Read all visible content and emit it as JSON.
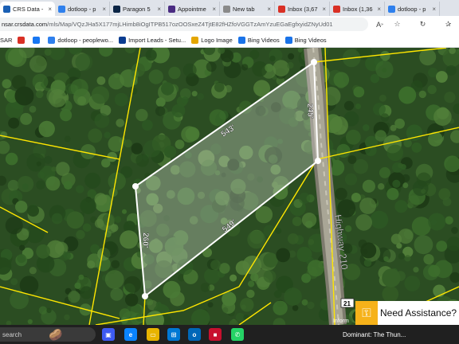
{
  "tabs": [
    {
      "label": "CRS Data -",
      "icon": "crs-icon",
      "color": "#1a5fb4",
      "active": true
    },
    {
      "label": "dotloop - p",
      "icon": "dotloop-icon",
      "color": "#2f80ed"
    },
    {
      "label": "Paragon 5",
      "icon": "paragon-icon",
      "color": "#0b2545"
    },
    {
      "label": "Appointme",
      "icon": "appointment-icon",
      "color": "#4a2c82"
    },
    {
      "label": "New tab",
      "icon": "newtab-icon",
      "color": "#8a8a8a"
    },
    {
      "label": "Inbox (3,67",
      "icon": "gmail-icon",
      "color": "#d93025"
    },
    {
      "label": "Inbox (1,36",
      "icon": "gmail-icon",
      "color": "#d93025"
    },
    {
      "label": "dotloop - p",
      "icon": "dotloop-icon",
      "color": "#2f80ed"
    }
  ],
  "address": {
    "host": "nsar.crsdata.com",
    "path": "/mls/Map/VQzJHa5X177mjLHimb8iOgITPB517ozOOSxeZ4TjtE82fHZfoVGGTzAmYzuEGaEgfxyidZNyUd01"
  },
  "bookmarks": [
    {
      "label": "SAR",
      "icon": "",
      "color": ""
    },
    {
      "label": "",
      "icon": "gmail-icon",
      "color": "#d93025"
    },
    {
      "label": "",
      "icon": "facebook-icon",
      "color": "#1877f2"
    },
    {
      "label": "dotloop - peoplewo...",
      "icon": "dotloop-icon",
      "color": "#2f80ed"
    },
    {
      "label": "Import Leads - Setu...",
      "icon": "import-icon",
      "color": "#0b3d91"
    },
    {
      "label": "Logo Image",
      "icon": "logo-image-icon",
      "color": "#e4a600"
    },
    {
      "label": "Bing Videos",
      "icon": "bing-icon",
      "color": "#1a73e8"
    },
    {
      "label": "Bing Videos",
      "icon": "bing-icon",
      "color": "#1a73e8"
    }
  ],
  "map": {
    "dimensions": [
      "543'",
      "245'",
      "549'",
      "260'"
    ],
    "road_label": "Highway 210",
    "shield_label": "21",
    "info_label": "Inform"
  },
  "assist": {
    "label": "Need Assistance?"
  },
  "taskbar": {
    "search": "search",
    "notification": "Dominant: The Thun..."
  },
  "colors": {
    "parcel_line": "#ffffff",
    "boundary": "#ffe600",
    "road": "#8a8778"
  }
}
